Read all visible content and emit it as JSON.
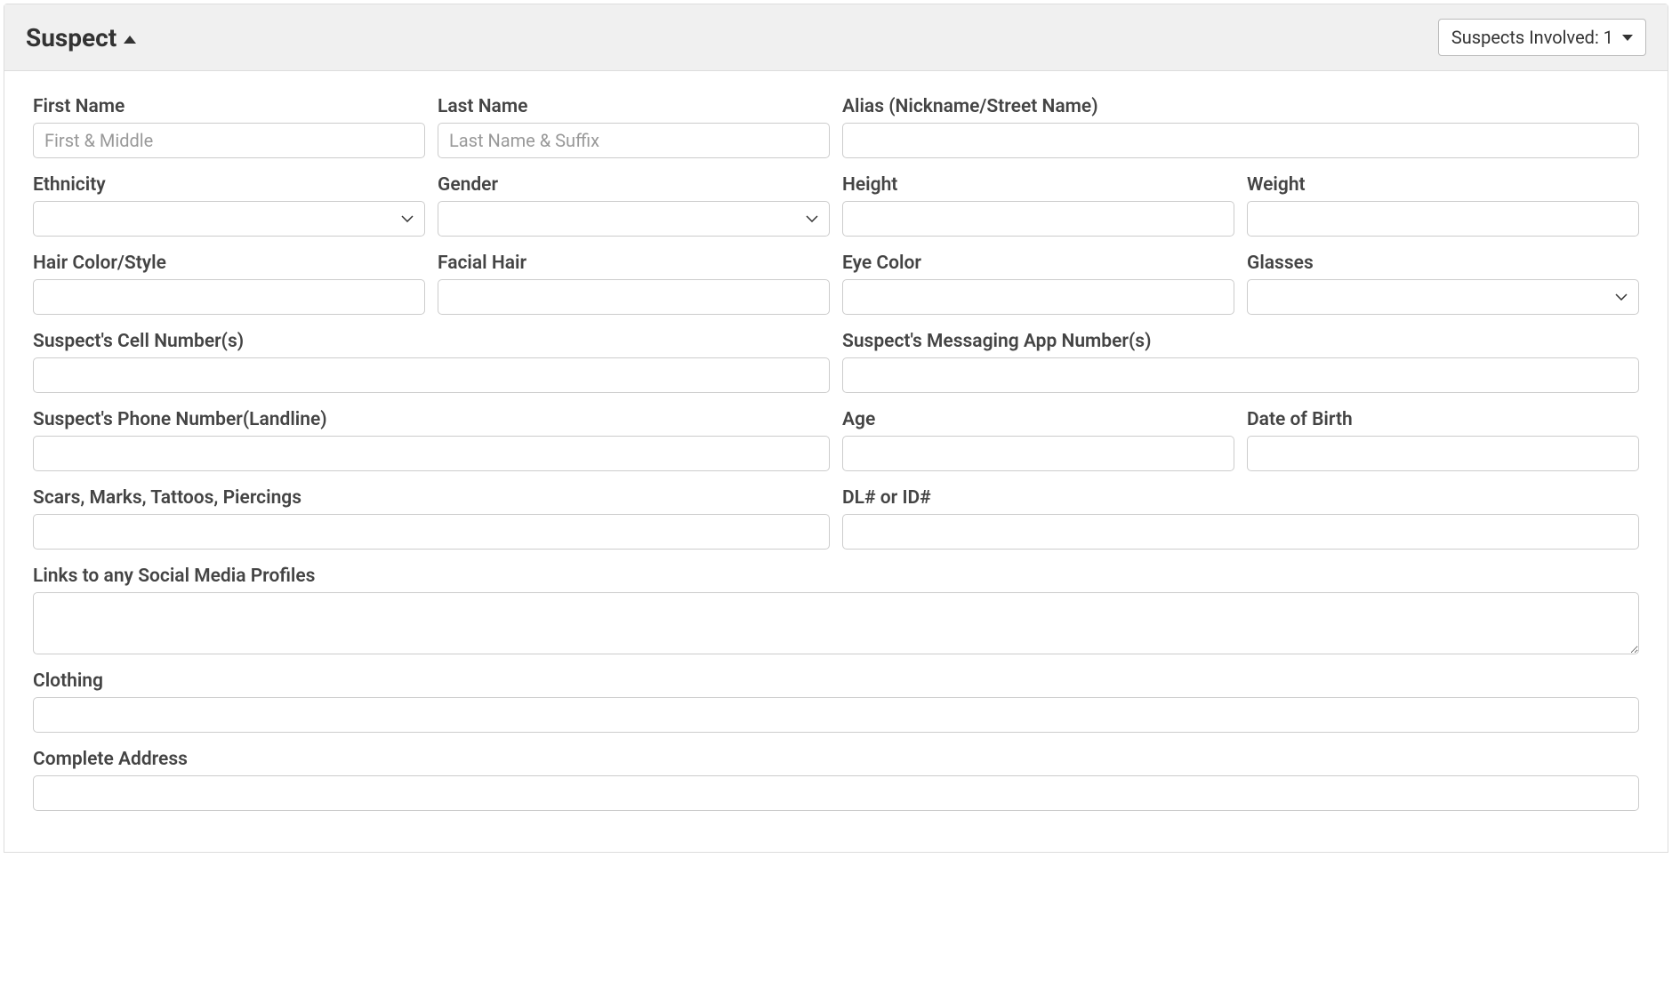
{
  "header": {
    "title": "Suspect",
    "suspects_involved_label": "Suspects Involved: 1"
  },
  "fields": {
    "first_name": {
      "label": "First Name",
      "placeholder": "First & Middle",
      "value": ""
    },
    "last_name": {
      "label": "Last Name",
      "placeholder": "Last Name & Suffix",
      "value": ""
    },
    "alias": {
      "label": "Alias (Nickname/Street Name)",
      "value": ""
    },
    "ethnicity": {
      "label": "Ethnicity",
      "value": ""
    },
    "gender": {
      "label": "Gender",
      "value": ""
    },
    "height": {
      "label": "Height",
      "value": ""
    },
    "weight": {
      "label": "Weight",
      "value": ""
    },
    "hair_color": {
      "label": "Hair Color/Style",
      "value": ""
    },
    "facial_hair": {
      "label": "Facial Hair",
      "value": ""
    },
    "eye_color": {
      "label": "Eye Color",
      "value": ""
    },
    "glasses": {
      "label": "Glasses",
      "value": ""
    },
    "cell_numbers": {
      "label": "Suspect's Cell Number(s)",
      "value": ""
    },
    "messaging_app": {
      "label": "Suspect's Messaging App Number(s)",
      "value": ""
    },
    "landline": {
      "label": "Suspect's Phone Number(Landline)",
      "value": ""
    },
    "age": {
      "label": "Age",
      "value": ""
    },
    "dob": {
      "label": "Date of Birth",
      "value": ""
    },
    "scars": {
      "label": "Scars, Marks, Tattoos, Piercings",
      "value": ""
    },
    "dl_id": {
      "label": "DL# or ID#",
      "value": ""
    },
    "social_media": {
      "label": "Links to any Social Media Profiles",
      "value": ""
    },
    "clothing": {
      "label": "Clothing",
      "value": ""
    },
    "address": {
      "label": "Complete Address",
      "value": ""
    }
  }
}
